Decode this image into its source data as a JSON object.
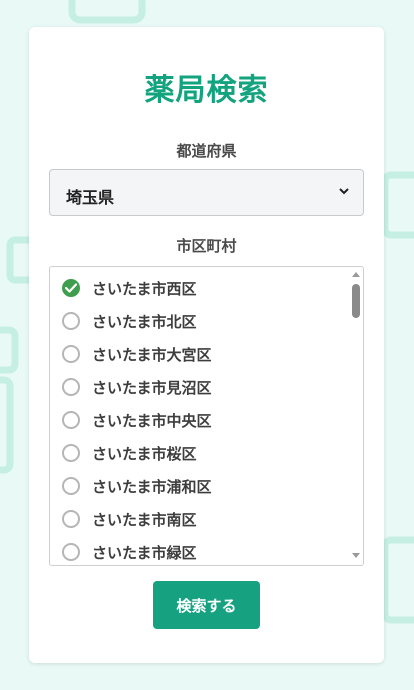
{
  "title": "薬局検索",
  "prefecture": {
    "label": "都道府県",
    "selected": "埼玉県"
  },
  "city": {
    "label": "市区町村",
    "options": [
      {
        "label": "さいたま市西区",
        "checked": true
      },
      {
        "label": "さいたま市北区",
        "checked": false
      },
      {
        "label": "さいたま市大宮区",
        "checked": false
      },
      {
        "label": "さいたま市見沼区",
        "checked": false
      },
      {
        "label": "さいたま市中央区",
        "checked": false
      },
      {
        "label": "さいたま市桜区",
        "checked": false
      },
      {
        "label": "さいたま市浦和区",
        "checked": false
      },
      {
        "label": "さいたま市南区",
        "checked": false
      },
      {
        "label": "さいたま市緑区",
        "checked": false
      }
    ]
  },
  "search_button": "検索する",
  "colors": {
    "accent": "#13a37f",
    "button": "#16a281",
    "check": "#3f9d4e",
    "background": "#e9faf6"
  }
}
